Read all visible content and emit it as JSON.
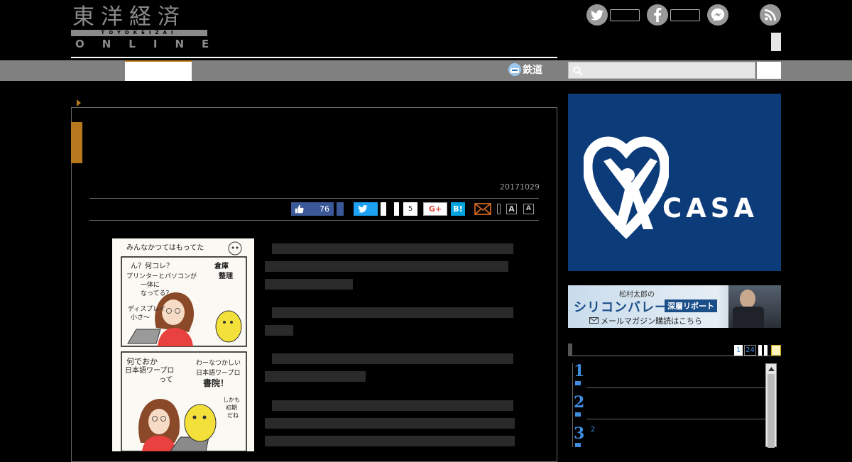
{
  "logo": {
    "kanji": "東洋経済",
    "band": "TOYOKEIZAI",
    "online": "ONLINE"
  },
  "header": {
    "social": [
      "twitter-icon",
      "facebook-icon",
      "messenger-icon",
      "rss-icon"
    ]
  },
  "nav": {
    "rail_label": "鉄道"
  },
  "search": {
    "placeholder": ""
  },
  "article": {
    "date": "20171029",
    "share": {
      "like_count": "76",
      "tweet_count": "5",
      "gplus_label": "G+",
      "hatena_label": "B!",
      "font_large": "A",
      "font_small": "A"
    }
  },
  "comic": {
    "panel1_top": "みんなかつてはもってた",
    "panel1_q": "ん？何コレ？",
    "panel1_a": "プリンターとパソコンが",
    "panel1_b": "一体に",
    "panel1_c": "なってる？",
    "panel1_d": "ディスプレイ",
    "panel1_e": "小さ〜",
    "panel1_tag": "倉庫",
    "panel1_tag2": "整理",
    "panel2_a": "何でおか",
    "panel2_b": "日本語ワープロ",
    "panel2_c": "って",
    "panel2_d": "わーなつかしい",
    "panel2_e": "日本語ワープロ",
    "panel2_f": "書院！",
    "panel2_g": "しかも",
    "panel2_h": "初期",
    "panel2_i": "だね"
  },
  "sidebar": {
    "casa_word": "CASA",
    "sv_author": "松村太郎の",
    "sv_title": "シリコンバレー",
    "sv_badge": "深層リポート",
    "sv_mail": "メールマガジン購読はこちら",
    "rank_tabs": [
      "1",
      "24"
    ],
    "rank_items": [
      {
        "num": "1",
        "sub": ""
      },
      {
        "num": "2",
        "sub": ""
      },
      {
        "num": "3",
        "sub": "2"
      }
    ]
  },
  "colors": {
    "accent": "#b8781e",
    "nav": "#808080",
    "casa": "#0c3b7a",
    "rank": "#3f8ddf"
  }
}
